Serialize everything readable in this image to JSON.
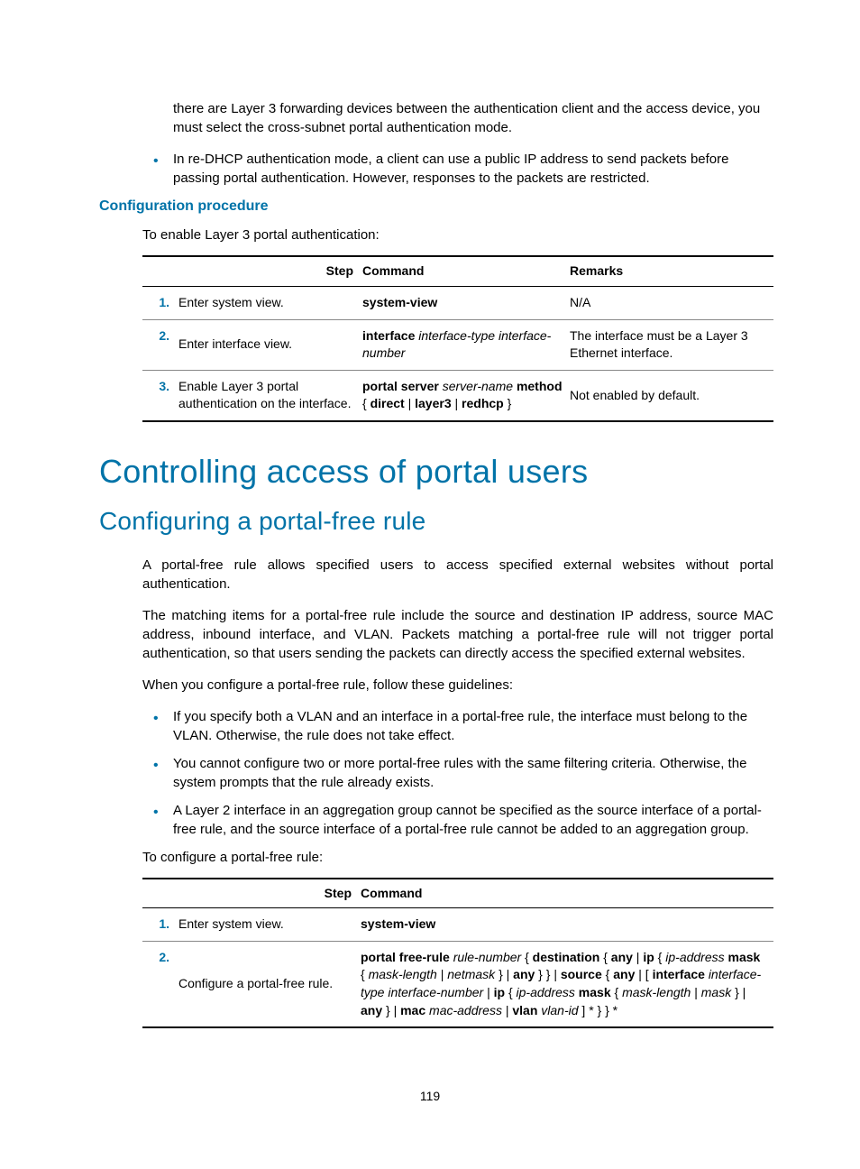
{
  "intro": {
    "continuation": "there are Layer 3 forwarding devices between the authentication client and the access device, you must select the cross-subnet portal authentication mode.",
    "bullet1": "In re-DHCP authentication mode, a client can use a public IP address to send packets before passing portal authentication. However, responses to the packets are restricted."
  },
  "section1": {
    "heading": "Configuration procedure",
    "lead": "To enable Layer 3 portal authentication:"
  },
  "table1": {
    "headers": {
      "step": "Step",
      "command": "Command",
      "remarks": "Remarks"
    },
    "rows": [
      {
        "num": "1.",
        "step": "Enter system view.",
        "command_html": "<b>system-view</b>",
        "remarks": "N/A"
      },
      {
        "num": "2.",
        "step": "Enter interface view.",
        "command_html": "<b>interface</b> <i>interface-type interface-number</i>",
        "remarks": "The interface must be a Layer 3 Ethernet interface."
      },
      {
        "num": "3.",
        "step": "Enable Layer 3 portal authentication on the interface.",
        "command_html": "<b>portal server</b> <i>server-name</i> <b>method</b> { <b>direct</b> | <b>layer3</b> | <b>redhcp</b> }",
        "remarks": "Not enabled by default."
      }
    ]
  },
  "h1": "Controlling access of portal users",
  "h2": "Configuring a portal-free rule",
  "paras": {
    "p1": "A portal-free rule allows specified users to access specified external websites without portal authentication.",
    "p2": "The matching items for a portal-free rule include the source and destination IP address, source MAC address, inbound interface, and VLAN. Packets matching a portal-free rule will not trigger portal authentication, so that users sending the packets can directly access the specified external websites.",
    "p3": "When you configure a portal-free rule, follow these guidelines:"
  },
  "guidelines": [
    "If you specify both a VLAN and an interface in a portal-free rule, the interface must belong to the VLAN. Otherwise, the rule does not take effect.",
    "You cannot configure two or more portal-free rules with the same filtering criteria. Otherwise, the system prompts that the rule already exists.",
    "A Layer 2 interface in an aggregation group cannot be specified as the source interface of a portal-free rule, and the source interface of a portal-free rule cannot be added to an aggregation group."
  ],
  "lead2": "To configure a portal-free rule:",
  "table2": {
    "headers": {
      "step": "Step",
      "command": "Command"
    },
    "rows": [
      {
        "num": "1.",
        "step": "Enter system view.",
        "command_html": "<b>system-view</b>"
      },
      {
        "num": "2.",
        "step": "Configure a portal-free rule.",
        "command_html": "<b>portal free-rule</b> <i>rule-number</i> { <b>destination</b> { <b>any</b> | <b>ip</b> { <i>ip-address</i> <b>mask</b> { <i>mask-length</i> | <i>netmask</i> } | <b>any</b> } } | <b>source</b> { <b>any</b> | [ <b>interface</b> <i>interface-type interface-number</i> | <b>ip</b> { <i>ip-address</i> <b>mask</b> { <i>mask-length</i> | <i>mask</i> } | <b>any</b> } | <b>mac</b> <i>mac-address</i> | <b>vlan</b> <i>vlan-id</i> ] * } } *"
      }
    ]
  },
  "pagenum": "119"
}
